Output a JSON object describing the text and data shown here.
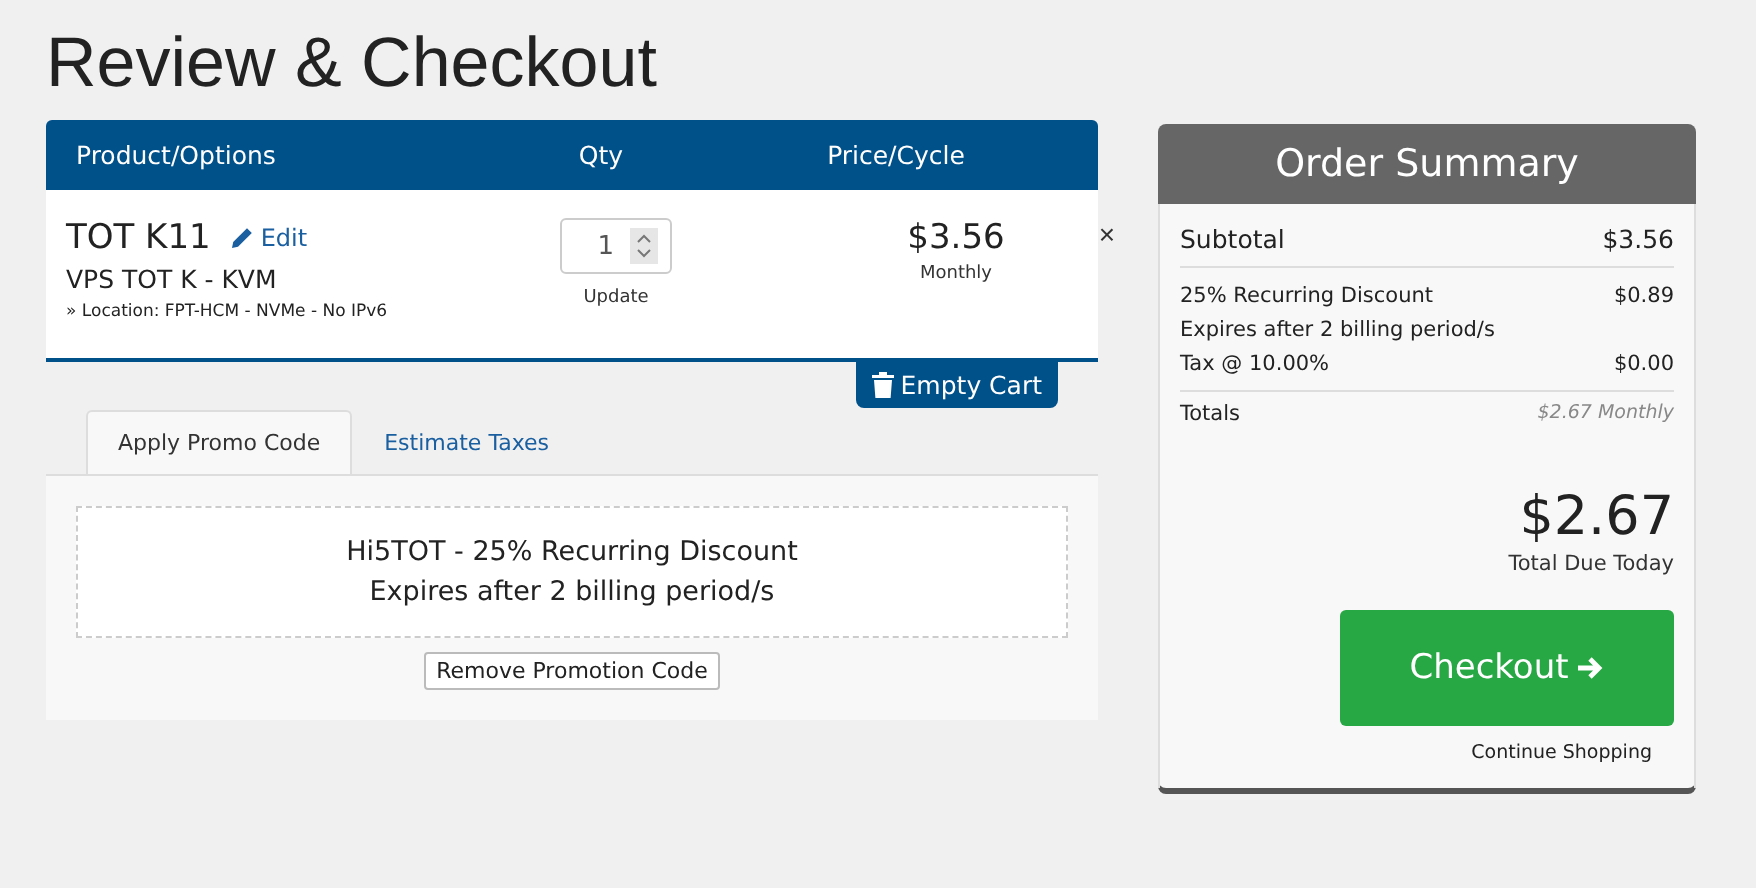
{
  "page_title": "Review & Checkout",
  "cart": {
    "columns": [
      "Product/Options",
      "Qty",
      "Price/Cycle"
    ],
    "items": [
      {
        "name": "TOT K11",
        "edit": "Edit",
        "group": "VPS TOT K - KVM",
        "option": "» Location: FPT-HCM - NVMe - No IPv6",
        "qty": "1",
        "update": "Update",
        "price": "$3.56",
        "cycle": "Monthly",
        "remove": "×"
      }
    ],
    "empty_cart": "Empty Cart"
  },
  "tabs": [
    {
      "label": "Apply Promo Code",
      "selected": true
    },
    {
      "label": "Estimate Taxes",
      "selected": false
    }
  ],
  "promo": {
    "lines": [
      "Hi5TOT - 25% Recurring Discount",
      "Expires after 2 billing period/s"
    ],
    "remove_button": "Remove Promotion Code"
  },
  "summary": {
    "title": "Order Summary",
    "subtotal_label": "Subtotal",
    "subtotal": "$3.56",
    "lines": [
      {
        "label": "25% Recurring Discount",
        "value": "$0.89"
      },
      {
        "label": "Expires after 2 billing period/s"
      },
      {
        "label": "Tax @ 10.00%",
        "value": "$0.00"
      }
    ],
    "totals_label": "Totals",
    "totals": "$2.67 Monthly",
    "total_due": "$2.67",
    "total_due_label": "Total Due Today",
    "checkout": "Checkout",
    "continue": "Continue Shopping"
  }
}
